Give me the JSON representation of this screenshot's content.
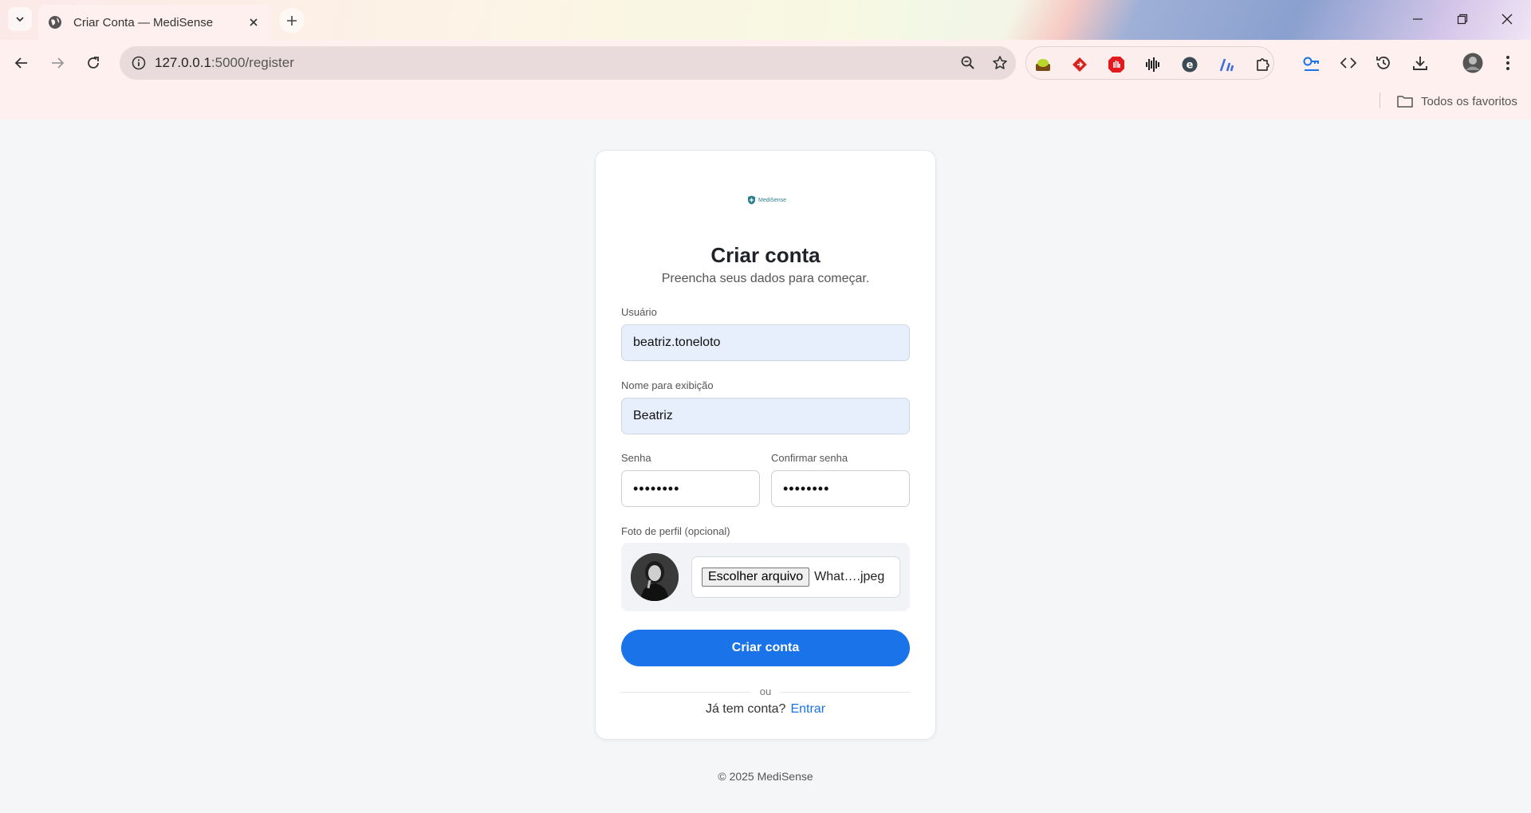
{
  "browser": {
    "tab_title": "Criar Conta — MediSense",
    "url_host": "127.0.0.1",
    "url_path": ":5000/register",
    "bookmarks_label": "Todos os favoritos",
    "extensions": [
      "green-extension-icon",
      "red-diamond-extension-icon",
      "red-hand-extension-icon",
      "audio-bars-extension-icon",
      "circle-letter-extension-icon",
      "blue-chart-extension-icon",
      "puzzle-extensions-icon"
    ]
  },
  "page": {
    "logo_text": "MediSense",
    "title": "Criar conta",
    "subtitle": "Preencha seus dados para começar.",
    "username_label": "Usuário",
    "username_value": "beatriz.toneloto",
    "display_name_label": "Nome para exibição",
    "display_name_value": "Beatriz",
    "password_label": "Senha",
    "password_value": "••••••••",
    "confirm_label": "Confirmar senha",
    "confirm_value": "••••••••",
    "photo_label": "Foto de perfil (opcional)",
    "file_button": "Escolher arquivo",
    "file_name": "What….jpeg",
    "submit_label": "Criar conta",
    "divider_text": "ou",
    "has_account_text": "Já tem conta?",
    "login_link": "Entrar",
    "footer": "© 2025 MediSense"
  },
  "colors": {
    "accent": "#1a73e8",
    "autofill_bg": "#e8effc",
    "page_bg": "#f5f6f8"
  }
}
